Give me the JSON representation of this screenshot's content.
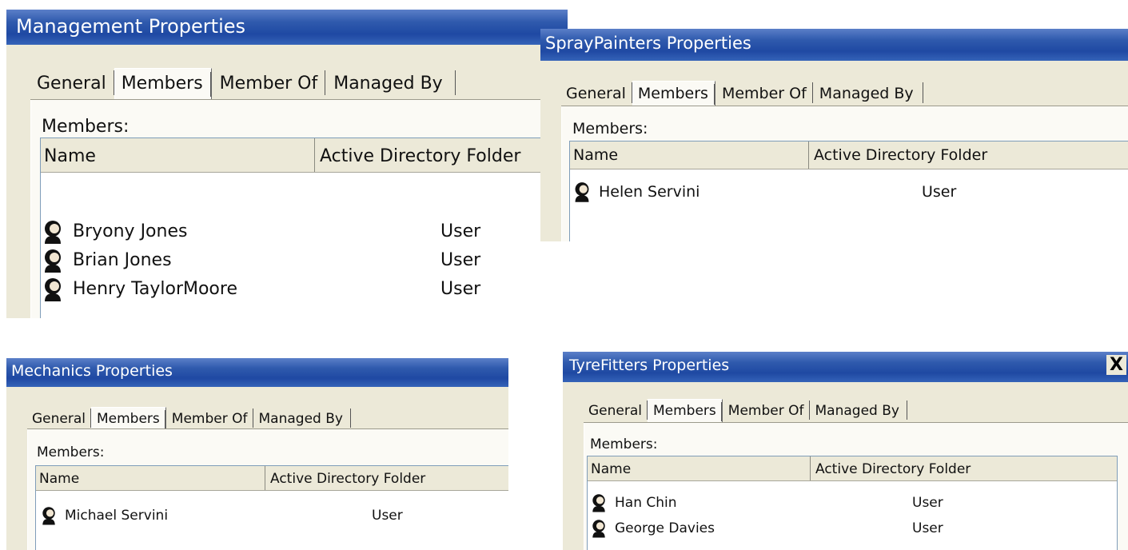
{
  "dialogs": {
    "management": {
      "title": "Management Properties",
      "tabs": [
        "General",
        "Members",
        "Member Of",
        "Managed By"
      ],
      "members_label": "Members:",
      "columns": [
        "Name",
        "Active Directory Folder"
      ],
      "members": [
        {
          "name": "Bryony Jones",
          "folder": "User"
        },
        {
          "name": "Brian Jones",
          "folder": "User"
        },
        {
          "name": "Henry TaylorMoore",
          "folder": "User"
        }
      ]
    },
    "spraypainters": {
      "title": "SprayPainters Properties",
      "tabs": [
        "General",
        "Members",
        "Member Of",
        "Managed By"
      ],
      "members_label": "Members:",
      "columns": [
        "Name",
        "Active Directory Folder"
      ],
      "members": [
        {
          "name": "Helen Servini",
          "folder": "User"
        }
      ]
    },
    "mechanics": {
      "title": "Mechanics Properties",
      "tabs": [
        "General",
        "Members",
        "Member Of",
        "Managed By"
      ],
      "members_label": "Members:",
      "columns": [
        "Name",
        "Active Directory Folder"
      ],
      "members": [
        {
          "name": "Michael Servini",
          "folder": "User"
        }
      ]
    },
    "tyrefitters": {
      "title": "TyreFitters Properties",
      "close_glyph": "X",
      "tabs": [
        "General",
        "Members",
        "Member Of",
        "Managed By"
      ],
      "members_label": "Members:",
      "columns": [
        "Name",
        "Active Directory Folder"
      ],
      "members": [
        {
          "name": "Han Chin",
          "folder": "User"
        },
        {
          "name": "George Davies",
          "folder": "User"
        }
      ]
    }
  },
  "icons": {
    "member": "user-icon",
    "close": "close-icon"
  },
  "colors": {
    "titlebar": "#1f49a3",
    "dialog_face": "#ece9d8",
    "listview_border": "#7f9db9"
  }
}
